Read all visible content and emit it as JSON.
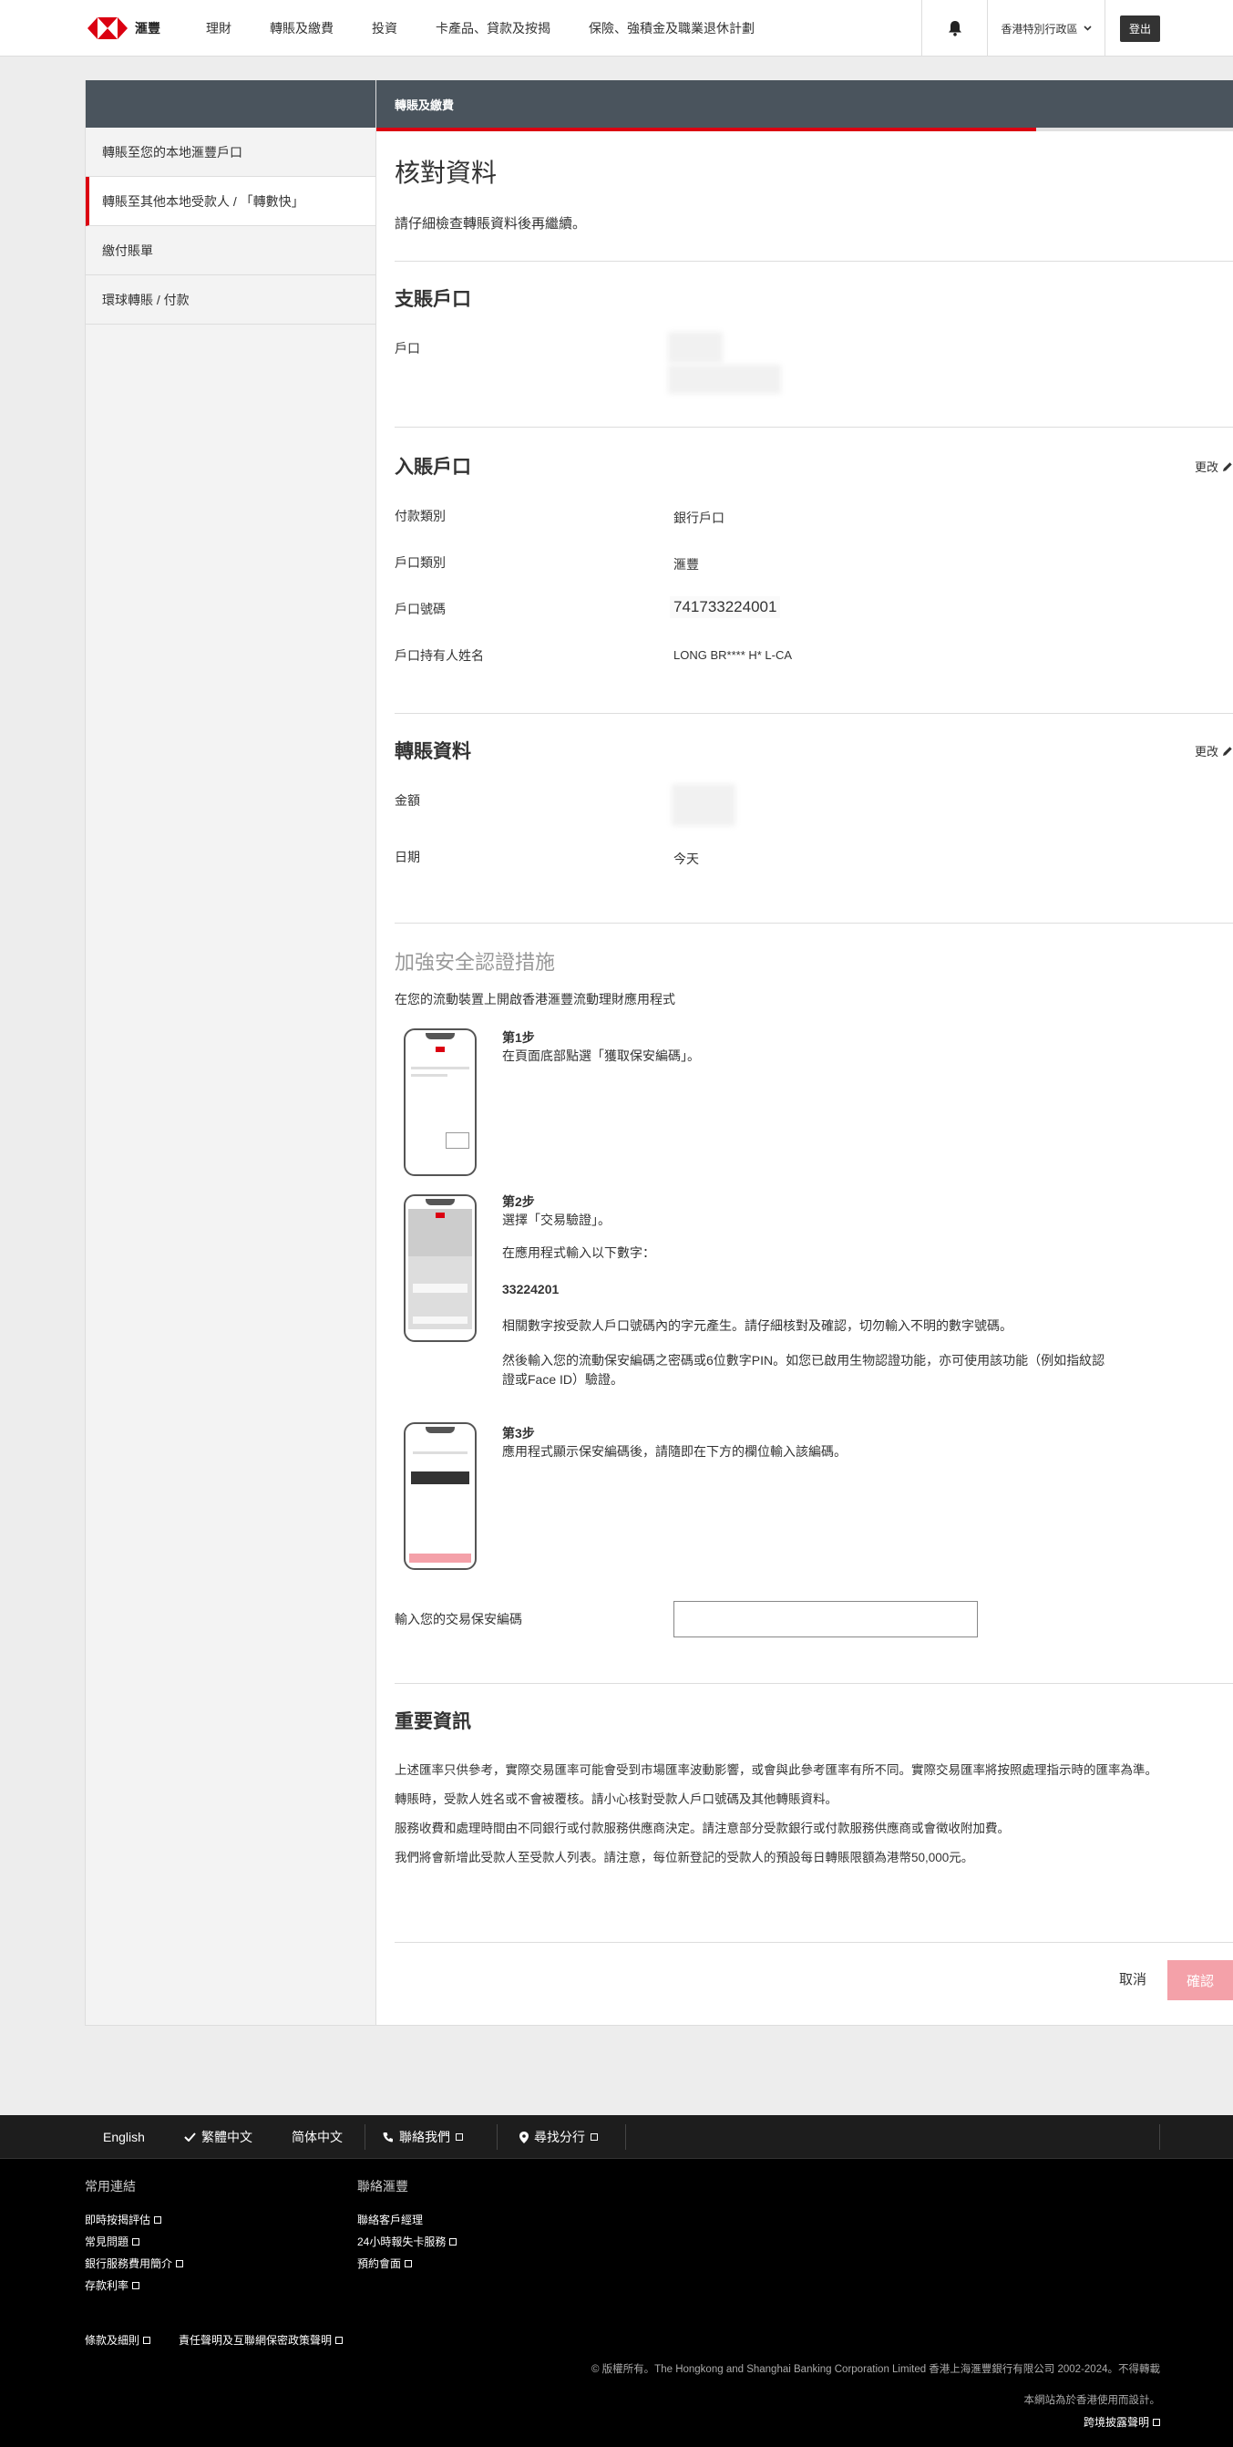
{
  "nav": {
    "brand": "滙豐",
    "items": [
      "理財",
      "轉賬及繳費",
      "投資",
      "卡產品、貸款及按揭",
      "保險、強積金及職業退休計劃"
    ],
    "region": "香港特別行政區",
    "logout": "登出"
  },
  "sidebar": {
    "items": [
      "轉賬至您的本地滙豐戶口",
      "轉賬至其他本地受款人 / 「轉數快」",
      "繳付賬單",
      "環球轉賬 / 付款"
    ]
  },
  "header": {
    "title": "轉賬及繳費",
    "progress": 0.77
  },
  "page": {
    "title": "核對資料",
    "subtitle": "請仔細檢查轉賬資料後再繼續。"
  },
  "from_account": {
    "title": "支賬戶口",
    "account_label": "戶口"
  },
  "to_account": {
    "title": "入賬戶口",
    "edit": "更改",
    "payment_type_label": "付款類別",
    "payment_type": "銀行戶口",
    "account_type_label": "戶口類別",
    "account_type": "滙豐",
    "account_no_label": "戶口號碼",
    "account_no": "741733224001",
    "holder_label": "戶口持有人姓名",
    "holder": "LONG BR**** H* L-CA"
  },
  "transfer": {
    "title": "轉賬資料",
    "edit": "更改",
    "amount_label": "金額",
    "date_label": "日期",
    "date": "今天"
  },
  "security": {
    "title": "加強安全認證措施",
    "intro": "在您的流動裝置上開啟香港滙豐流動理財應用程式",
    "step1_title": "第1步",
    "step1_text": "在頁面底部點選「獲取保安編碼」。",
    "step2_title": "第2步",
    "step2_text1": "選擇「交易驗證」。",
    "step2_text2": "在應用程式輸入以下數字：",
    "step2_code": "33224201",
    "step2_text3": "相關數字按受款人戶口號碼內的字元產生。請仔細核對及確認，切勿輸入不明的數字號碼。",
    "step2_text4": "然後輸入您的流動保安編碼之密碼或6位數字PIN。如您已啟用生物認證功能，亦可使用該功能（例如指紋認",
    "step2_text5": "證或Face ID）驗證。",
    "step3_title": "第3步",
    "step3_text": "應用程式顯示保安編碼後，請隨即在下方的欄位輸入該編碼。",
    "input_label": "輸入您的交易保安編碼"
  },
  "important": {
    "title": "重要資訊",
    "lines": [
      "上述匯率只供參考，實際交易匯率可能會受到市場匯率波動影響，或會與此參考匯率有所不同。實際交易匯率將按照處理指示時的匯率為準。",
      "轉賬時，受款人姓名或不會被覆核。請小心核對受款人戶口號碼及其他轉賬資料。",
      "服務收費和處理時間由不同銀行或付款服務供應商決定。請注意部分受款銀行或付款服務供應商或會徵收附加費。",
      "我們將會新增此受款人至受款人列表。請注意，每位新登記的受款人的預設每日轉賬限額為港幣50,000元。"
    ]
  },
  "actions": {
    "cancel": "取消",
    "confirm": "確認"
  },
  "footer": {
    "lang_en": "English",
    "lang_tc": "繁體中文",
    "lang_sc": "简体中文",
    "contact": "聯絡我們",
    "branch": "尋找分行",
    "col1_title": "常用連結",
    "col1_links": [
      "即時按揭評估",
      "常見問題",
      "銀行服務費用簡介",
      "存款利率"
    ],
    "col2_title": "聯絡滙豐",
    "col2_links": [
      "聯絡客戶經理",
      "24小時報失卡服務",
      "預約會面"
    ],
    "terms": "條款及細則",
    "privacy": "責任聲明及互聯網保密政策聲明",
    "copyright": "© 版權所有。The Hongkong and Shanghai Banking Corporation Limited 香港上海滙豐銀行有限公司 2002-2024。不得轉載",
    "designed": "本網站為於香港使用而設計。",
    "cross_border": "跨境披露聲明"
  },
  "colors": {
    "brand_red": "#db0011",
    "header_slate": "#4a545d",
    "confirm_disabled": "#f4a1a9"
  }
}
